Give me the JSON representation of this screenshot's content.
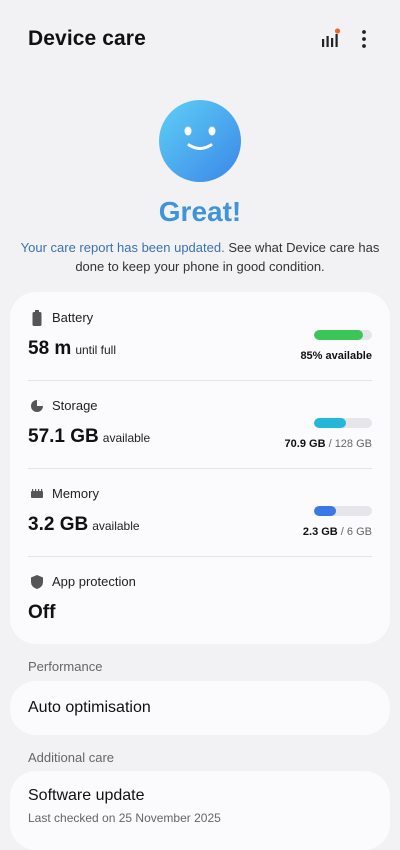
{
  "header": {
    "title": "Device care",
    "stats_icon": "bar-chart-icon",
    "more_icon": "more-vert-icon",
    "notification_dot_color": "#ea6a2a"
  },
  "status": {
    "face_icon": "smiley-face-icon",
    "headline": "Great!",
    "report_link": "Your care report has been updated.",
    "report_text": " See what Device care has done to keep your phone in good condition.",
    "accent_color": "#3f94dc"
  },
  "cards": {
    "battery": {
      "label": "Battery",
      "icon": "battery-icon",
      "value": "58 m",
      "suffix": "until full",
      "meta": "85% available",
      "fill_fraction": 0.85,
      "bar_color": "#3cc65a"
    },
    "storage": {
      "label": "Storage",
      "icon": "pie-chart-icon",
      "value": "57.1 GB",
      "suffix": "available",
      "used": "70.9 GB",
      "total": "128 GB",
      "fill_fraction": 0.554,
      "bar_color": "#23b8d8"
    },
    "memory": {
      "label": "Memory",
      "icon": "memory-chip-icon",
      "value": "3.2 GB",
      "suffix": "available",
      "used": "2.3 GB",
      "total": "6 GB",
      "fill_fraction": 0.383,
      "bar_color": "#3a78e6"
    },
    "protection": {
      "label": "App protection",
      "icon": "shield-icon",
      "value": "Off"
    }
  },
  "performance": {
    "section_label": "Performance",
    "auto_optimisation": "Auto optimisation"
  },
  "additional": {
    "section_label": "Additional care",
    "software_update": "Software update",
    "last_checked": "Last checked on 25 November 2025"
  }
}
